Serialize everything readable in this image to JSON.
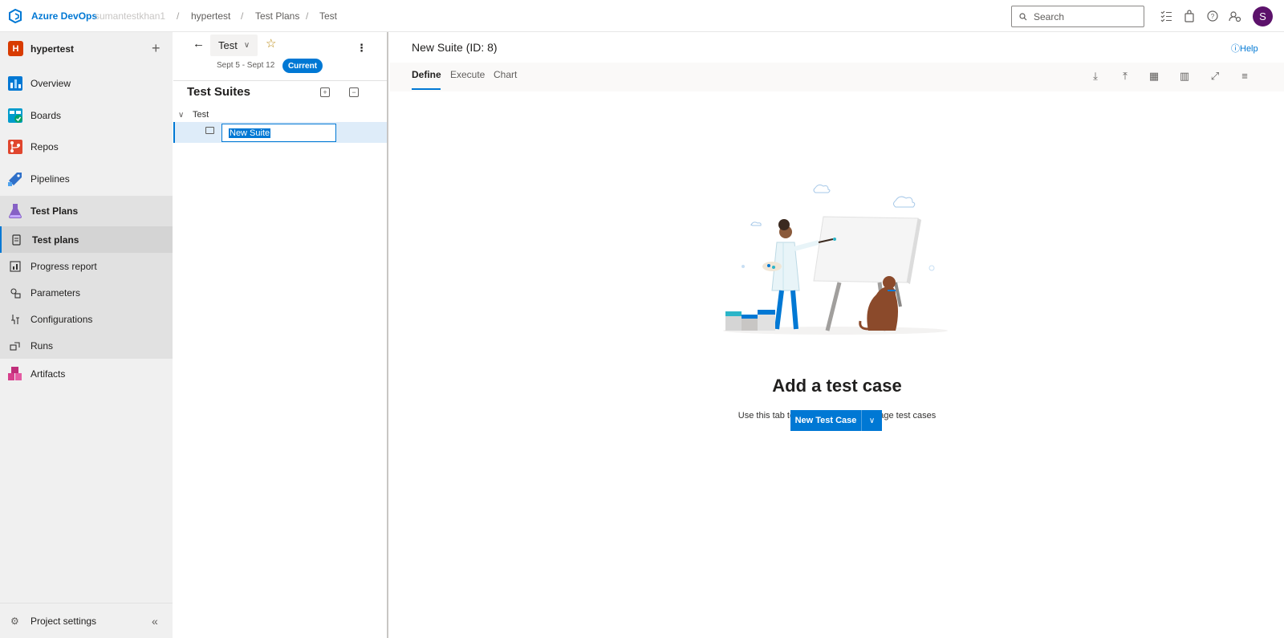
{
  "topbar": {
    "brand": "Azure DevOps",
    "org": "sumantestkhan1",
    "breadcrumbs": [
      "hypertest",
      "Test Plans",
      "Test"
    ],
    "search_placeholder": "Search",
    "avatar_initial": "S"
  },
  "leftnav": {
    "project_initial": "H",
    "project_name": "hypertest",
    "items": [
      {
        "label": "Overview",
        "icon": "overview-icon"
      },
      {
        "label": "Boards",
        "icon": "boards-icon"
      },
      {
        "label": "Repos",
        "icon": "repos-icon"
      },
      {
        "label": "Pipelines",
        "icon": "pipelines-icon"
      },
      {
        "label": "Test Plans",
        "icon": "test-plans-icon"
      },
      {
        "label": "Artifacts",
        "icon": "artifacts-icon"
      }
    ],
    "sub_items": [
      {
        "label": "Test plans",
        "icon": "test-plans-doc-icon"
      },
      {
        "label": "Progress report",
        "icon": "progress-report-icon"
      },
      {
        "label": "Parameters",
        "icon": "parameters-icon"
      },
      {
        "label": "Configurations",
        "icon": "configurations-icon"
      },
      {
        "label": "Runs",
        "icon": "runs-icon"
      }
    ],
    "settings_label": "Project settings"
  },
  "plan": {
    "name": "Test",
    "dates": "Sept 5 - Sept 12",
    "status": "Current"
  },
  "suites": {
    "title": "Test Suites",
    "root": "Test",
    "editing_value": "New Suite"
  },
  "main": {
    "title": "New Suite (ID: 8)",
    "help": "Help",
    "tabs": [
      "Define",
      "Execute",
      "Chart"
    ],
    "empty_title": "Add a test case",
    "empty_subtitle": "Use this tab to collate, add and manage test cases",
    "cta_label": "New Test Case"
  },
  "colors": {
    "accent": "#0078d4",
    "project_badge": "#d83b01",
    "avatar": "#5c126b"
  }
}
